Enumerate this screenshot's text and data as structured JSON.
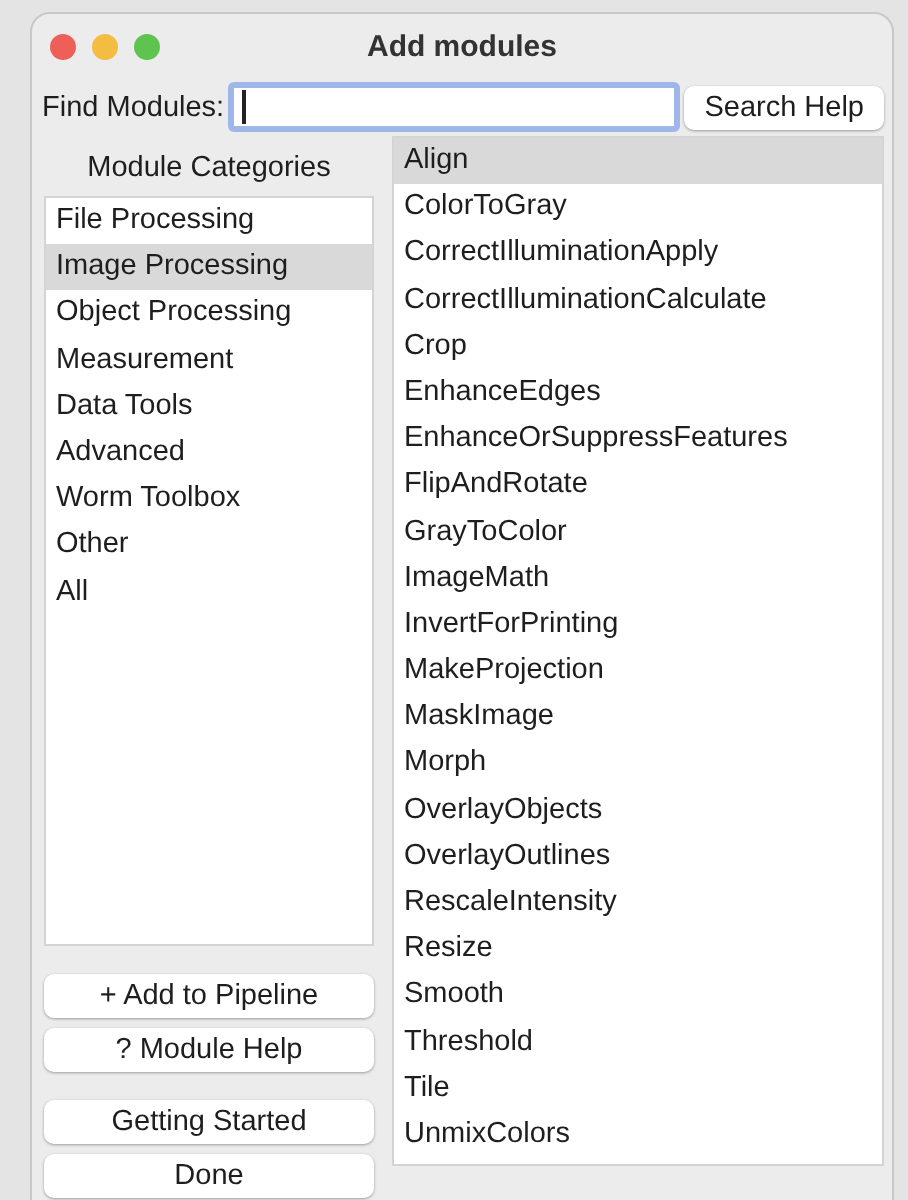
{
  "window": {
    "title": "Add modules"
  },
  "search": {
    "label": "Find Modules:",
    "help_button": "Search Help"
  },
  "categories": {
    "heading": "Module Categories",
    "items": [
      {
        "label": "File Processing",
        "selected": false
      },
      {
        "label": "Image Processing",
        "selected": true
      },
      {
        "label": "Object Processing",
        "selected": false
      },
      {
        "label": "Measurement",
        "selected": false
      },
      {
        "label": "Data Tools",
        "selected": false
      },
      {
        "label": "Advanced",
        "selected": false
      },
      {
        "label": "Worm Toolbox",
        "selected": false
      },
      {
        "label": "Other",
        "selected": false
      },
      {
        "label": "All",
        "selected": false
      }
    ]
  },
  "buttons": [
    "+ Add to Pipeline",
    "? Module Help"
  ],
  "bottom_buttons": [
    "Getting Started",
    "Done"
  ],
  "modules": [
    {
      "label": "Align",
      "selected": true
    },
    {
      "label": "ColorToGray",
      "selected": false
    },
    {
      "label": "CorrectIlluminationApply",
      "selected": false
    },
    {
      "label": "CorrectIlluminationCalculate",
      "selected": false
    },
    {
      "label": "Crop",
      "selected": false
    },
    {
      "label": "EnhanceEdges",
      "selected": false
    },
    {
      "label": "EnhanceOrSuppressFeatures",
      "selected": false
    },
    {
      "label": "FlipAndRotate",
      "selected": false
    },
    {
      "label": "GrayToColor",
      "selected": false
    },
    {
      "label": "ImageMath",
      "selected": false
    },
    {
      "label": "InvertForPrinting",
      "selected": false
    },
    {
      "label": "MakeProjection",
      "selected": false
    },
    {
      "label": "MaskImage",
      "selected": false
    },
    {
      "label": "Morph",
      "selected": false
    },
    {
      "label": "OverlayObjects",
      "selected": false
    },
    {
      "label": "OverlayOutlines",
      "selected": false
    },
    {
      "label": "RescaleIntensity",
      "selected": false
    },
    {
      "label": "Resize",
      "selected": false
    },
    {
      "label": "Smooth",
      "selected": false
    },
    {
      "label": "Threshold",
      "selected": false
    },
    {
      "label": "Tile",
      "selected": false
    },
    {
      "label": "UnmixColors",
      "selected": false
    }
  ]
}
